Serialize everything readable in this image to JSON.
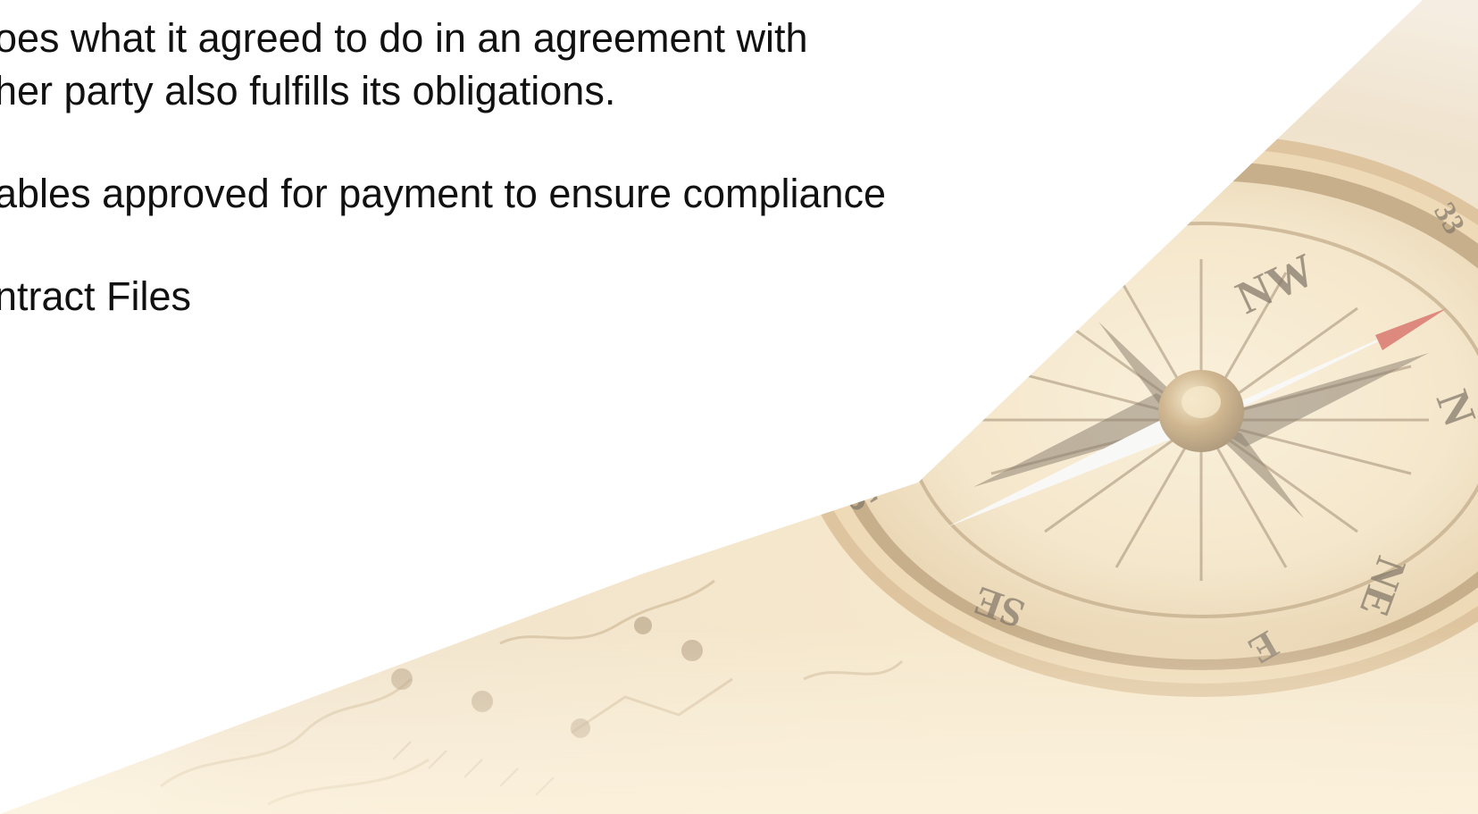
{
  "slide": {
    "body_lines": [
      "oes what it agreed to do in an agreement with",
      "her party also fulfills its obligations.",
      "ables approved for payment to ensure compliance",
      "ntract Files"
    ]
  },
  "decor": {
    "image": "vintage-compass-on-map-photo",
    "compass_labels": [
      "NW",
      "N",
      "NE",
      "E",
      "SE",
      "S"
    ],
    "compass_numeral": "33"
  },
  "colors": {
    "text": "#111111",
    "background": "#ffffff",
    "sepia_light": "#f1e3c7",
    "sepia_mid": "#d9bd8c",
    "sepia_dark": "#8a6534",
    "brass": "#b9944f"
  }
}
